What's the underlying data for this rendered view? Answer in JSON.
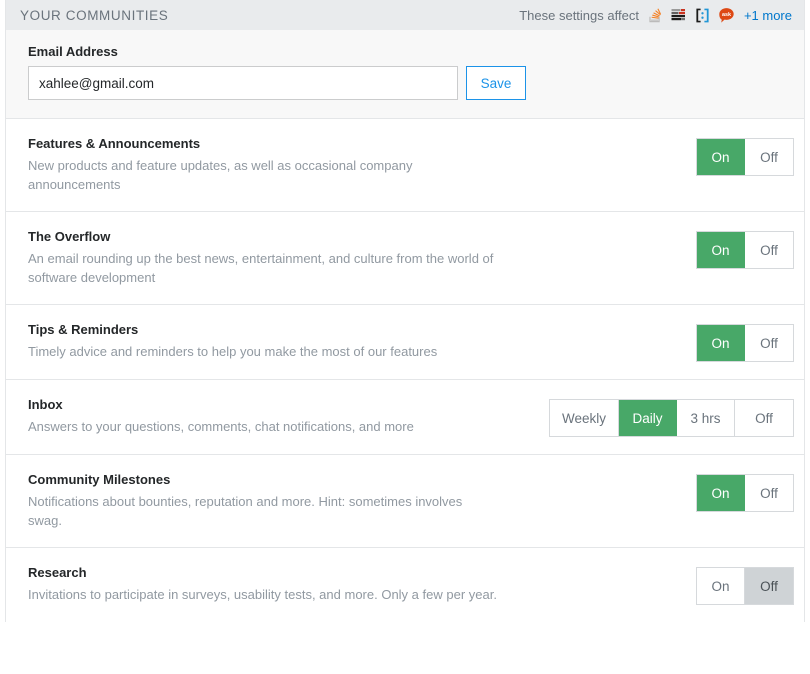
{
  "header": {
    "title": "YOUR COMMUNITIES",
    "affect_label": "These settings affect",
    "more_label": "+1 more",
    "icons": [
      {
        "name": "stack-overflow-java-icon",
        "alt": "Stack Overflow"
      },
      {
        "name": "server-fault-icon",
        "alt": "Server Fault"
      },
      {
        "name": "code-golf-icon",
        "alt": "Code Golf"
      },
      {
        "name": "ask-ubuntu-icon",
        "alt": "Ask Ubuntu"
      }
    ]
  },
  "email": {
    "label": "Email Address",
    "value": "xahlee@gmail.com",
    "placeholder": "Email Address",
    "save_label": "Save"
  },
  "settings": [
    {
      "title": "Features & Announcements",
      "description": "New products and feature updates, as well as occasional company announcements",
      "options": [
        "On",
        "Off"
      ],
      "selected": "On",
      "style": "on"
    },
    {
      "title": "The Overflow",
      "description": "An email rounding up the best news, entertainment, and culture from the world of software development",
      "options": [
        "On",
        "Off"
      ],
      "selected": "On",
      "style": "on"
    },
    {
      "title": "Tips & Reminders",
      "description": "Timely advice and reminders to help you make the most of our features",
      "options": [
        "On",
        "Off"
      ],
      "selected": "On",
      "style": "on"
    },
    {
      "title": "Inbox",
      "description": "Answers to your questions, comments, chat notifications, and more",
      "options": [
        "Weekly",
        "Daily",
        "3 hrs",
        "Off"
      ],
      "selected": "Daily",
      "style": "on"
    },
    {
      "title": "Community Milestones",
      "description": "Notifications about bounties, reputation and more. Hint: sometimes involves swag.",
      "options": [
        "On",
        "Off"
      ],
      "selected": "On",
      "style": "on"
    },
    {
      "title": "Research",
      "description": "Invitations to participate in surveys, usability tests, and more. Only a few per year.",
      "options": [
        "On",
        "Off"
      ],
      "selected": "Off",
      "style": "off"
    }
  ],
  "colors": {
    "accent_green": "#48a868",
    "link_blue": "#0077cc",
    "save_blue": "#1c93e8",
    "header_bg": "#e9ebed",
    "muted_text": "#9199a1",
    "off_selected_bg": "#cfd3d6"
  }
}
